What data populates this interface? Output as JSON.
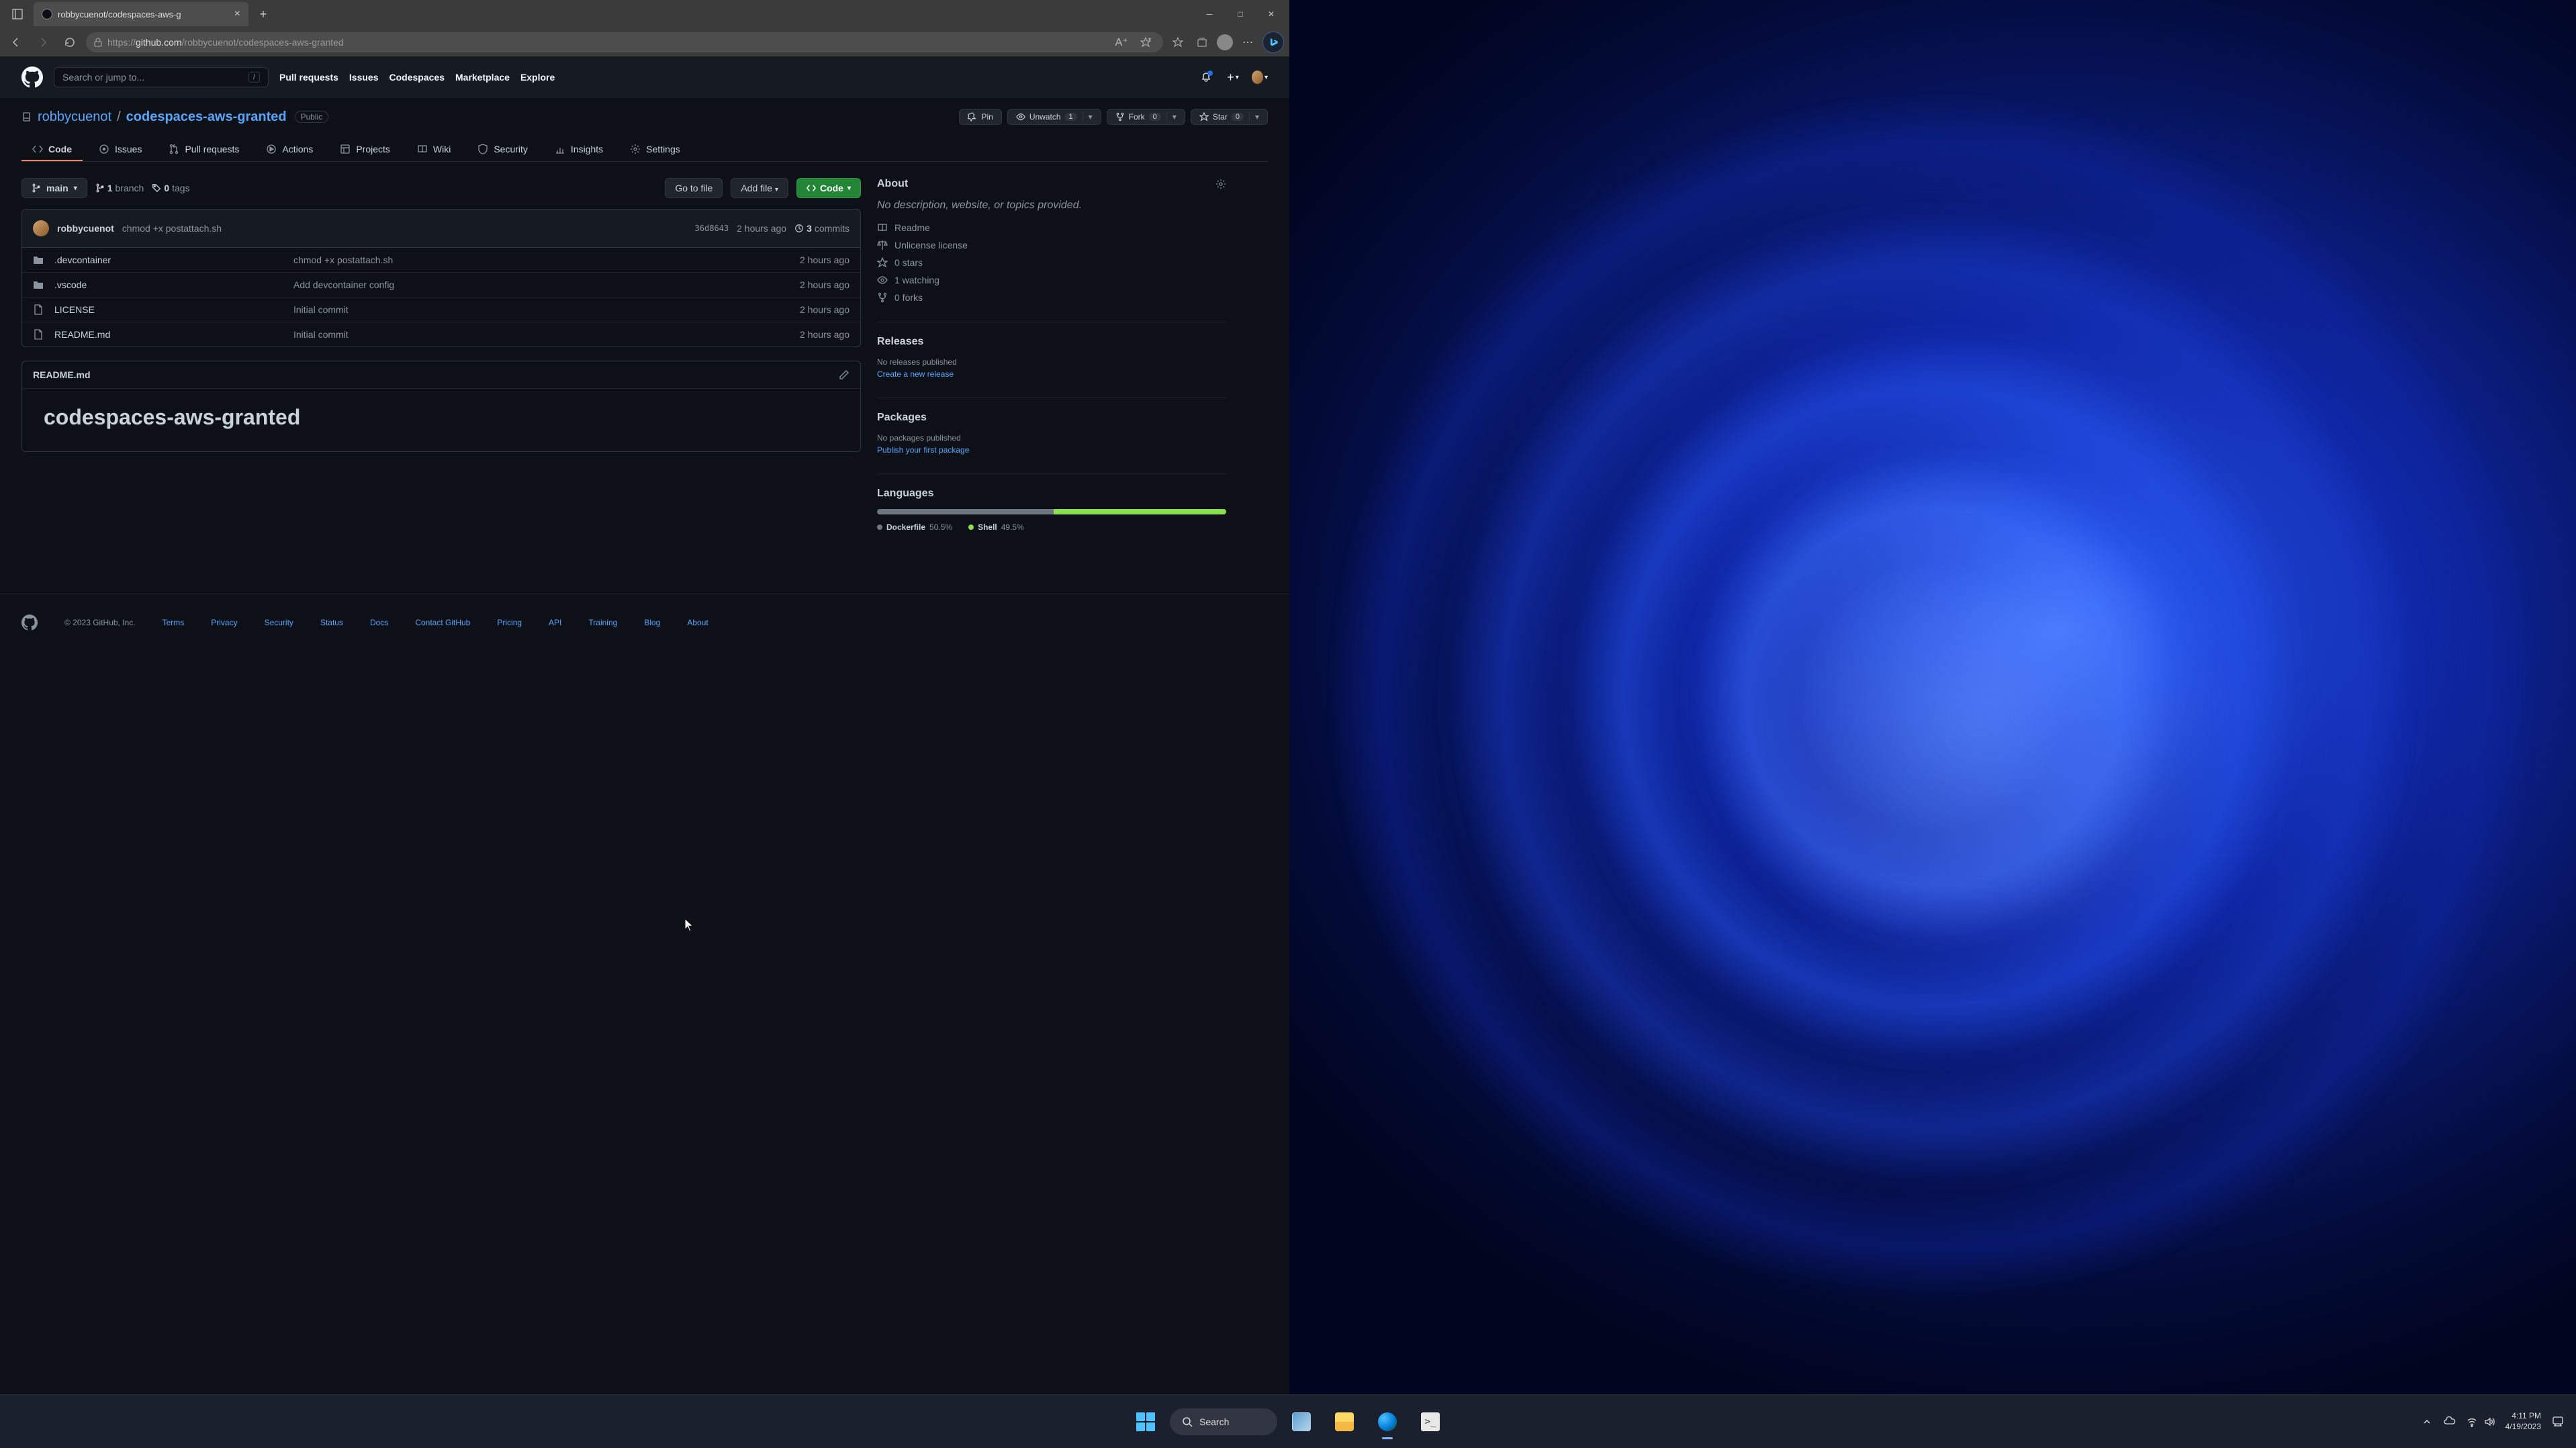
{
  "browser": {
    "tab_title": "robbycuenot/codespaces-aws-g",
    "url_prefix": "https://",
    "url_host": "github.com",
    "url_path": "/robbycuenot/codespaces-aws-granted"
  },
  "gh_header": {
    "search_placeholder": "Search or jump to...",
    "search_key": "/",
    "nav": [
      "Pull requests",
      "Issues",
      "Codespaces",
      "Marketplace",
      "Explore"
    ]
  },
  "repo": {
    "owner": "robbycuenot",
    "name": "codespaces-aws-granted",
    "visibility": "Public",
    "actions": {
      "pin": "Pin",
      "unwatch": "Unwatch",
      "unwatch_count": "1",
      "fork": "Fork",
      "fork_count": "0",
      "star": "Star",
      "star_count": "0"
    },
    "nav": [
      "Code",
      "Issues",
      "Pull requests",
      "Actions",
      "Projects",
      "Wiki",
      "Security",
      "Insights",
      "Settings"
    ]
  },
  "files": {
    "branch": "main",
    "branches_num": "1",
    "branches_label": "branch",
    "tags_num": "0",
    "tags_label": "tags",
    "go_to_file": "Go to file",
    "add_file": "Add file",
    "code_btn": "Code",
    "commit_author": "robbycuenot",
    "commit_msg": "chmod +x postattach.sh",
    "commit_sha": "36d8643",
    "commit_time": "2 hours ago",
    "commits_num": "3",
    "commits_label": "commits",
    "rows": [
      {
        "type": "folder",
        "name": ".devcontainer",
        "msg": "chmod +x postattach.sh",
        "time": "2 hours ago"
      },
      {
        "type": "folder",
        "name": ".vscode",
        "msg": "Add devcontainer config",
        "time": "2 hours ago"
      },
      {
        "type": "file",
        "name": "LICENSE",
        "msg": "Initial commit",
        "time": "2 hours ago"
      },
      {
        "type": "file",
        "name": "README.md",
        "msg": "Initial commit",
        "time": "2 hours ago"
      }
    ]
  },
  "readme": {
    "filename": "README.md",
    "heading": "codespaces-aws-granted"
  },
  "about": {
    "title": "About",
    "description": "No description, website, or topics provided.",
    "readme": "Readme",
    "license": "Unlicense license",
    "stars": "0 stars",
    "watching": "1 watching",
    "forks": "0 forks"
  },
  "releases": {
    "title": "Releases",
    "empty": "No releases published",
    "link": "Create a new release"
  },
  "packages": {
    "title": "Packages",
    "empty": "No packages published",
    "link": "Publish your first package"
  },
  "languages": {
    "title": "Languages",
    "items": [
      {
        "name": "Dockerfile",
        "pct": "50.5%",
        "color": "#6e7681",
        "width": "50.5%"
      },
      {
        "name": "Shell",
        "pct": "49.5%",
        "color": "#89e051",
        "width": "49.5%"
      }
    ]
  },
  "footer": {
    "copyright": "© 2023 GitHub, Inc.",
    "links": [
      "Terms",
      "Privacy",
      "Security",
      "Status",
      "Docs",
      "Contact GitHub",
      "Pricing",
      "API",
      "Training",
      "Blog",
      "About"
    ]
  },
  "taskbar": {
    "search": "Search",
    "time": "4:11 PM",
    "date": "4/19/2023"
  }
}
